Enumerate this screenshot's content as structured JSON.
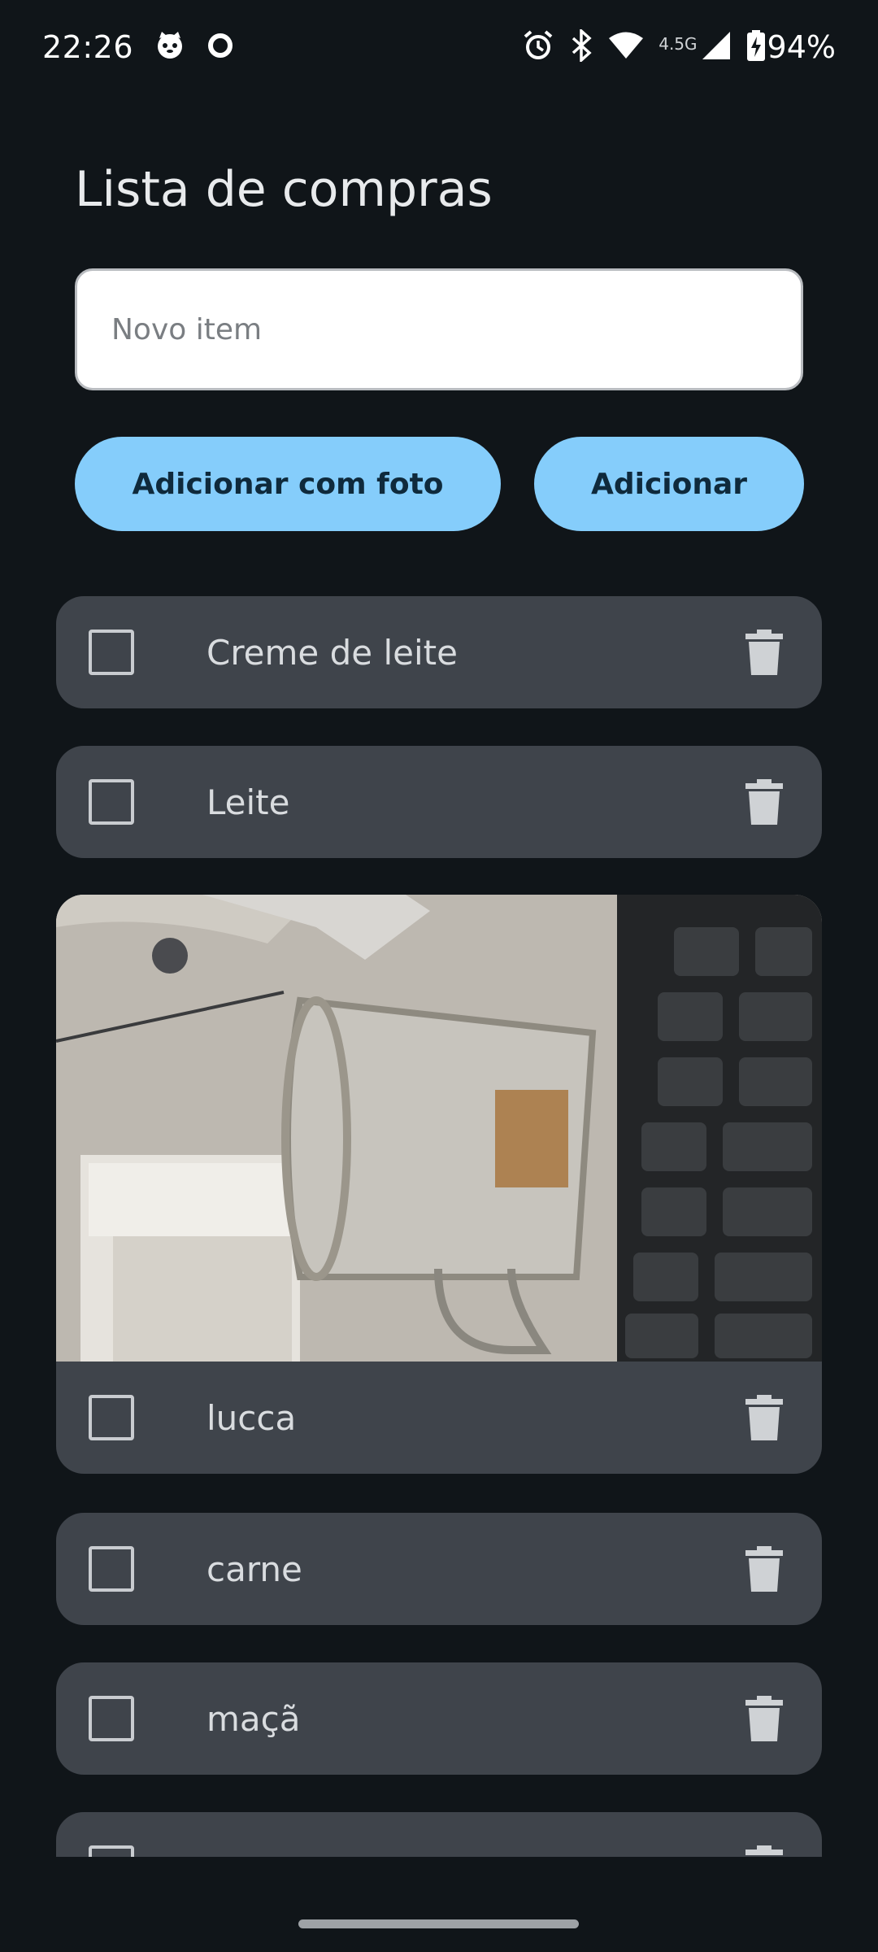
{
  "status_bar": {
    "time": "22:26",
    "network_type": "4.5G",
    "battery": "94%",
    "icons": [
      "cat-icon",
      "circle-icon",
      "alarm-icon",
      "bluetooth-icon",
      "wifi-icon",
      "signal-icon",
      "battery-icon"
    ]
  },
  "header": {
    "title": "Lista de compras"
  },
  "input": {
    "placeholder": "Novo item",
    "value": ""
  },
  "buttons": {
    "add_with_photo": "Adicionar com foto",
    "add": "Adicionar"
  },
  "colors": {
    "background": "#101519",
    "card": "#3f444b",
    "accent": "#85cdfb",
    "accent_text": "#0f2a3c"
  },
  "items": [
    {
      "label": "Creme de leite",
      "checked": false,
      "has_photo": false
    },
    {
      "label": "Leite",
      "checked": false,
      "has_photo": false
    },
    {
      "label": "lucca",
      "checked": false,
      "has_photo": true
    },
    {
      "label": "carne",
      "checked": false,
      "has_photo": false
    },
    {
      "label": "maçã",
      "checked": false,
      "has_photo": false
    },
    {
      "label": "",
      "checked": false,
      "has_photo": false
    }
  ]
}
